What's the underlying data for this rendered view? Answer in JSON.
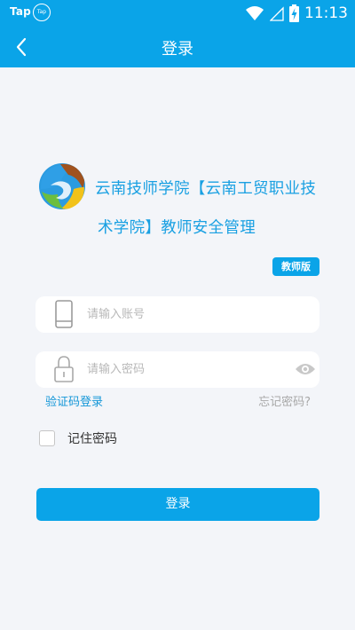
{
  "status_bar": {
    "carrier_text": "Tap",
    "app_icon_text": "Tap",
    "time": "11:13",
    "icons": [
      "wifi-icon",
      "signal-icon",
      "battery-charging-icon"
    ]
  },
  "header": {
    "title": "登录",
    "back_icon": "chevron-left-icon"
  },
  "school": {
    "name_line1": "云南技师学院【云南工贸职业技",
    "name_line2": "术学院】教师安全管理",
    "badge": "教师版"
  },
  "form": {
    "account_placeholder": "请输入账号",
    "account_value": "",
    "password_placeholder": "请输入密码",
    "password_value": "",
    "sms_login": "验证码登录",
    "forgot_password": "忘记密码?",
    "remember_label": "记住密码",
    "remember_checked": false,
    "submit_label": "登录"
  },
  "colors": {
    "brand": "#0aa4e8",
    "link": "#1597d8",
    "muted": "#a8a8a8",
    "background": "#f3f5f9"
  }
}
